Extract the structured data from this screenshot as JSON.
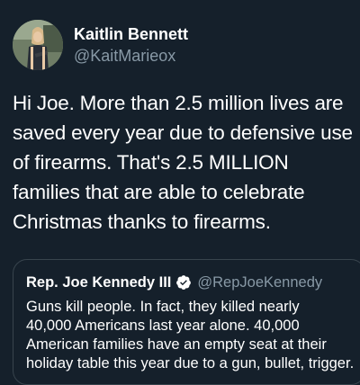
{
  "tweet": {
    "author": {
      "display_name": "Kaitlin Bennett",
      "handle": "@KaitMarieox"
    },
    "text_lines": [
      "Hi Joe. More than 2.5 million lives are",
      "saved every year due to defensive use",
      "of firearms. That's 2.5 MILLION",
      "families that are able to celebrate",
      "Christmas thanks to firearms."
    ]
  },
  "quoted_tweet": {
    "display_name": "Rep. Joe Kennedy III",
    "handle": "@RepJoeKennedy",
    "verified": true,
    "text_lines": [
      "Guns kill people. In fact, they killed nearly",
      "40,000 Americans last year alone. 40,000",
      "American families have an empty seat at their",
      "holiday table this year due to a gun, bullet, trigger."
    ]
  },
  "colors": {
    "background": "#15202b",
    "primary_text": "#ffffff",
    "secondary_text": "#8899a6",
    "border": "#38444d",
    "verified_badge": "#ffffff"
  }
}
